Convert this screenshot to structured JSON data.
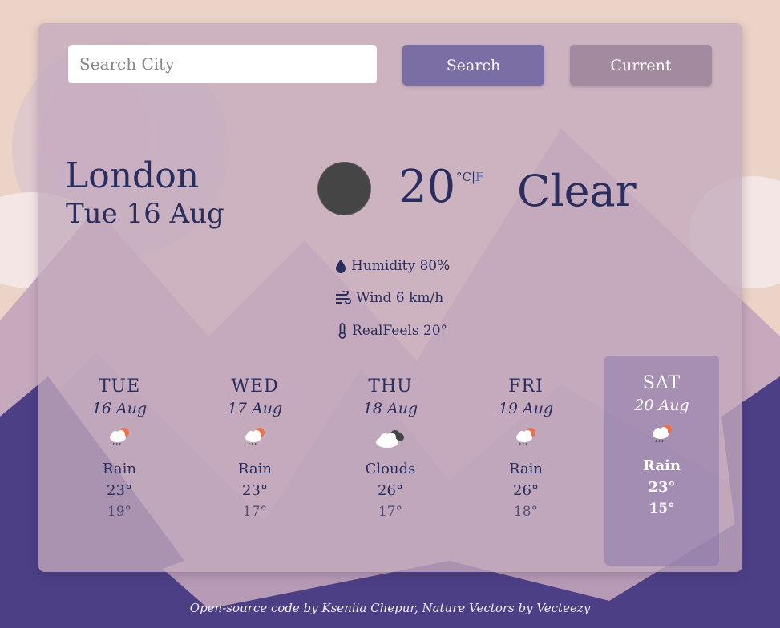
{
  "search": {
    "placeholder": "Search City",
    "button_label": "Search",
    "current_label": "Current"
  },
  "current": {
    "city": "London",
    "date": "Tue 16 Aug",
    "temperature": "20",
    "unit_c": "°C",
    "unit_sep": "|",
    "unit_f": "F",
    "description": "Clear",
    "humidity": "Humidity 80%",
    "wind": "Wind 6 km/h",
    "realfeel": "RealFeels 20°",
    "icon": "clear-night-icon"
  },
  "forecast": [
    {
      "day": "TUE",
      "date": "16 Aug",
      "condition": "Rain",
      "high": "23°",
      "low": "19°",
      "icon": "rain-sun-icon"
    },
    {
      "day": "WED",
      "date": "17 Aug",
      "condition": "Rain",
      "high": "23°",
      "low": "17°",
      "icon": "rain-sun-icon"
    },
    {
      "day": "THU",
      "date": "18 Aug",
      "condition": "Clouds",
      "high": "26°",
      "low": "17°",
      "icon": "clouds-icon"
    },
    {
      "day": "FRI",
      "date": "19 Aug",
      "condition": "Rain",
      "high": "26°",
      "low": "18°",
      "icon": "rain-sun-icon"
    },
    {
      "day": "SAT",
      "date": "20 Aug",
      "condition": "Rain",
      "high": "23°",
      "low": "15°",
      "icon": "rain-sun-icon"
    }
  ],
  "footer": "Open-source code by Kseniia Chepur, Nature Vectors by Vecteezy",
  "colors": {
    "text": "#2a2e5e",
    "search_button": "#7a6ea5",
    "current_button": "#a48a9e",
    "unit_link": "#3b6fe0"
  }
}
